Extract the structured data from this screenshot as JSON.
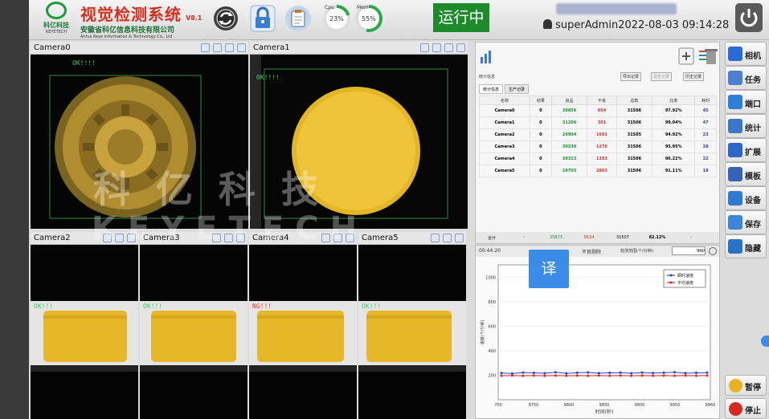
{
  "header": {
    "logo_cn": "科亿科技",
    "logo_en": "KEYETECH",
    "app_title": "视觉检测系统",
    "version": "V8.1",
    "company_cn": "安徽省科亿信息科技有限公司",
    "company_en": "Anhui Keye Information & Technology Co., Ltd",
    "cpu_label": "Cpu",
    "cpu_value": "23%",
    "mem_label": "Mem",
    "mem_value": "55%",
    "status": "运行中",
    "user": "superAdmin",
    "datetime": "2022-08-03 09:14:28"
  },
  "cameras": [
    {
      "title": "Camera0",
      "result": "OK!!!!"
    },
    {
      "title": "Camera1",
      "result": "OK!!!!"
    },
    {
      "title": "Camera2",
      "result": "OK!!!"
    },
    {
      "title": "Camera3",
      "result": "OK!!!"
    },
    {
      "title": "Camera4",
      "result": "NG!!!"
    },
    {
      "title": "Camera5",
      "result": "OK!!!"
    }
  ],
  "watermark": {
    "cn": "科 亿 科 技",
    "en": "KEYETECH"
  },
  "stats": {
    "panel_title": "统计信息",
    "export_label": "导出记录",
    "clear_label": "清空记录",
    "history_label": "历史记录",
    "tabs": [
      "统计信息",
      "生产记录"
    ],
    "columns": [
      "名称",
      "结果",
      "良品",
      "不良",
      "总数",
      "比率",
      "耗时"
    ],
    "rows": [
      [
        "Camera0",
        "0",
        "30856",
        "654",
        "31506",
        "97.92%",
        "45"
      ],
      [
        "Camera1",
        "0",
        "31206",
        "301",
        "31506",
        "99.04%",
        "47"
      ],
      [
        "Camera2",
        "0",
        "29904",
        "1601",
        "31505",
        "94.92%",
        "23"
      ],
      [
        "Camera3",
        "0",
        "30230",
        "1276",
        "31506",
        "95.95%",
        "28"
      ],
      [
        "Camera4",
        "0",
        "30313",
        "1193",
        "31506",
        "96.22%",
        "22"
      ],
      [
        "Camera5",
        "0",
        "28703",
        "2803",
        "31506",
        "91.11%",
        "18"
      ]
    ],
    "total": [
      "合计",
      "-",
      "25873",
      "5634",
      "31507",
      "82.12%",
      "-"
    ]
  },
  "trend": {
    "time": "00:44:20",
    "range_label": "不良剔除",
    "sample_label": "检测范围(个/分钟):",
    "sample_value": "960",
    "legend": [
      "瞬时速度",
      "平均速度"
    ],
    "ylabel": "速度(个/分钟)",
    "xlabel": "时间(秒)",
    "translate_label": "译"
  },
  "side_menu": [
    {
      "label": "相机",
      "color": "#2a6bd6"
    },
    {
      "label": "任务",
      "color": "#4c7fd0"
    },
    {
      "label": "端口",
      "color": "#2f7ed8"
    },
    {
      "label": "统计",
      "color": "#3a78c6"
    },
    {
      "label": "扩展",
      "color": "#2b66c8"
    },
    {
      "label": "模板",
      "color": "#3563b8"
    },
    {
      "label": "设备",
      "color": "#2d7bd0"
    },
    {
      "label": "保存",
      "color": "#3d86d6"
    },
    {
      "label": "隐藏",
      "color": "#2a74c8"
    }
  ],
  "controls": {
    "pause": "暂停",
    "stop": "停止"
  },
  "chart_data": {
    "type": "line",
    "title": "",
    "xlabel": "时间(秒)",
    "ylabel": "速度(个/分钟)",
    "x_ticks": [
      "700",
      "9750",
      "9800",
      "9850",
      "9900",
      "9950",
      "9960"
    ],
    "y_ticks": [
      "200",
      "400",
      "600",
      "800",
      "1000"
    ],
    "ylim": [
      0,
      1100
    ],
    "series": [
      {
        "name": "瞬时速度",
        "color": "#2b3fcf",
        "values": [
          218,
          214,
          222,
          219,
          216,
          224,
          215,
          220,
          223,
          217,
          219,
          221,
          216,
          222,
          218,
          220,
          224,
          217,
          219,
          221
        ]
      },
      {
        "name": "平均速度",
        "color": "#d62828",
        "values": [
          196,
          197,
          196,
          197,
          196,
          197,
          196,
          197,
          196,
          197,
          196,
          197,
          196,
          197,
          196,
          197,
          196,
          197,
          196,
          197
        ]
      }
    ],
    "legend": "top-right"
  }
}
